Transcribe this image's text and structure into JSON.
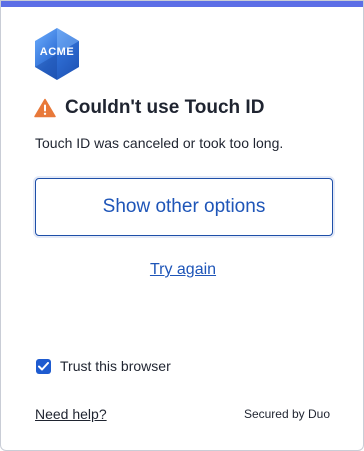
{
  "brand": {
    "logo_text": "ACME",
    "accent_color": "#5c6ee6",
    "logo_color": "#2f6fd6"
  },
  "dialog": {
    "title": "Couldn't use Touch ID",
    "warning_icon": "warning-triangle-icon",
    "message": "Touch ID was canceled or took too long.",
    "primary_button_label": "Show other options",
    "retry_link_label": "Try again",
    "trust_checkbox": {
      "label": "Trust this browser",
      "checked": true
    }
  },
  "footer": {
    "help_link_label": "Need help?",
    "secured_text": "Secured by Duo"
  }
}
